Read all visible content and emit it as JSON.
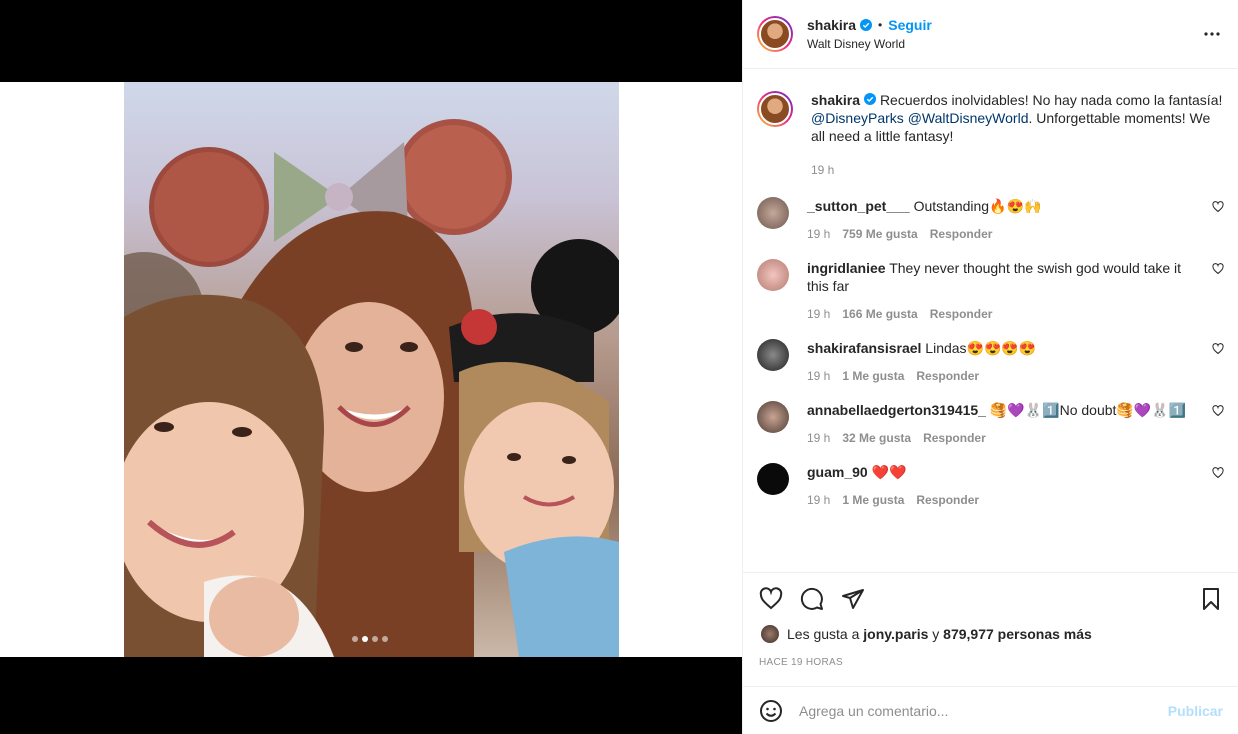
{
  "header": {
    "username": "shakira",
    "separator": "•",
    "follow_label": "Seguir",
    "location": "Walt Disney World"
  },
  "caption": {
    "username": "shakira",
    "text": "Recuerdos inolvidables! No hay nada como la fantasía!",
    "mention1": "@DisneyParks",
    "mention2": "@WaltDisneyWorld",
    "text2": ". Unforgettable moments! We all need a little fantasy!",
    "time": "19 h"
  },
  "comments": [
    {
      "username": "_sutton_pet___",
      "text": "Outstanding🔥😍🙌",
      "time": "19 h",
      "likes": "759 Me gusta",
      "reply": "Responder",
      "avatar_color": "#a88b80"
    },
    {
      "username": "ingridlaniee",
      "text": "They never thought the swish god would take it this far",
      "time": "19 h",
      "likes": "166 Me gusta",
      "reply": "Responder",
      "avatar_color": "#d9a7a0"
    },
    {
      "username": "shakirafansisrael",
      "text": "Lindas😍😍😍😍",
      "time": "19 h",
      "likes": "1 Me gusta",
      "reply": "Responder",
      "avatar_color": "#3b3b3b"
    },
    {
      "username": "annabellaedgerton319415_",
      "text": "🥞💜🐰1️⃣No doubt🥞💜🐰1️⃣",
      "time": "19 h",
      "likes": "32 Me gusta",
      "reply": "Responder",
      "avatar_color": "#8c6f62"
    },
    {
      "username": "guam_90",
      "text": "❤️❤️",
      "time": "19 h",
      "likes": "1 Me gusta",
      "reply": "Responder",
      "avatar_color": "#0a0a0a"
    }
  ],
  "likes": {
    "prefix": "Les gusta a",
    "user": "jony.paris",
    "connector": "y",
    "count": "879,977 personas más"
  },
  "timestamp": "HACE 19 HORAS",
  "add_comment": {
    "placeholder": "Agrega un comentario...",
    "publish_label": "Publicar"
  },
  "carousel": {
    "total": 4,
    "active_index": 1
  },
  "colors": {
    "accent": "#0095f6",
    "mention": "#00376b",
    "muted": "#8e8e8e"
  },
  "icons": [
    "heart-icon",
    "comment-icon",
    "share-icon",
    "bookmark-icon",
    "emoji-icon",
    "more-icon",
    "verified-icon",
    "chevron-left-icon",
    "chevron-right-icon"
  ]
}
